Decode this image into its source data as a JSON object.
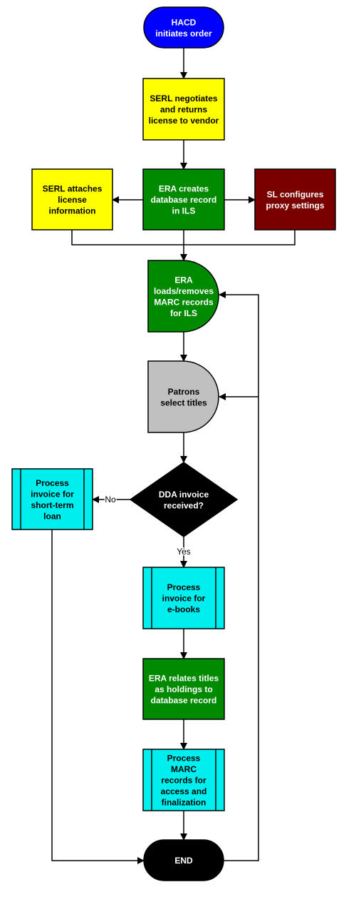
{
  "colors": {
    "start": "#0000ff",
    "yellow": "#ffff00",
    "green": "#008a00",
    "maroon": "#7a0000",
    "gray": "#c0c0c0",
    "cyan": "#00eeee",
    "black": "#000000"
  },
  "nodes": [
    {
      "id": "hacd",
      "shape": "terminator",
      "fill": "start",
      "text_color": "#ffffff",
      "lines": [
        "HACD",
        "initiates order"
      ]
    },
    {
      "id": "serl_negotiates",
      "shape": "process",
      "fill": "yellow",
      "text_color": "#000000",
      "lines": [
        "SERL negotiates",
        "and returns",
        "license to vendor"
      ]
    },
    {
      "id": "serl_attaches",
      "shape": "process",
      "fill": "yellow",
      "text_color": "#000000",
      "lines": [
        "SERL attaches",
        "license",
        "information"
      ]
    },
    {
      "id": "era_creates",
      "shape": "process",
      "fill": "green",
      "text_color": "#ffffff",
      "lines": [
        "ERA creates",
        "database record",
        "in ILS"
      ]
    },
    {
      "id": "sl_configures",
      "shape": "process",
      "fill": "maroon",
      "text_color": "#ffffff",
      "lines": [
        "SL configures",
        "proxy settings"
      ]
    },
    {
      "id": "era_loads",
      "shape": "delay",
      "fill": "green",
      "text_color": "#ffffff",
      "lines": [
        "ERA",
        "loads/removes",
        "MARC records",
        "for ILS"
      ]
    },
    {
      "id": "patrons",
      "shape": "delay",
      "fill": "gray",
      "text_color": "#000000",
      "lines": [
        "Patrons",
        "select titles"
      ]
    },
    {
      "id": "dda",
      "shape": "decision",
      "fill": "black",
      "text_color": "#ffffff",
      "lines": [
        "DDA invoice",
        "received?"
      ]
    },
    {
      "id": "short_term",
      "shape": "predefined",
      "fill": "cyan",
      "text_color": "#000000",
      "lines": [
        "Process",
        "invoice for",
        "short-term",
        "loan"
      ]
    },
    {
      "id": "ebooks",
      "shape": "predefined",
      "fill": "cyan",
      "text_color": "#000000",
      "lines": [
        "Process",
        "invoice for",
        "e-books"
      ]
    },
    {
      "id": "era_relates",
      "shape": "process",
      "fill": "green",
      "text_color": "#ffffff",
      "lines": [
        "ERA relates titles",
        "as holdings to",
        "database record"
      ]
    },
    {
      "id": "process_marc",
      "shape": "predefined",
      "fill": "cyan",
      "text_color": "#000000",
      "lines": [
        "Process",
        "MARC",
        "records for",
        "access and",
        "finalization"
      ]
    },
    {
      "id": "end",
      "shape": "terminator",
      "fill": "black",
      "text_color": "#ffffff",
      "lines": [
        "END"
      ]
    }
  ],
  "edges": [
    {
      "from": "hacd",
      "to": "serl_negotiates"
    },
    {
      "from": "serl_negotiates",
      "to": "era_creates"
    },
    {
      "from": "era_creates",
      "to": "serl_attaches"
    },
    {
      "from": "era_creates",
      "to": "sl_configures"
    },
    {
      "from": "era_creates",
      "to": "era_loads"
    },
    {
      "from": "serl_attaches",
      "to": "era_loads"
    },
    {
      "from": "sl_configures",
      "to": "era_loads"
    },
    {
      "from": "era_loads",
      "to": "patrons"
    },
    {
      "from": "patrons",
      "to": "dda"
    },
    {
      "from": "dda",
      "to": "short_term",
      "label": "No"
    },
    {
      "from": "dda",
      "to": "ebooks",
      "label": "Yes"
    },
    {
      "from": "ebooks",
      "to": "era_relates"
    },
    {
      "from": "era_relates",
      "to": "process_marc"
    },
    {
      "from": "process_marc",
      "to": "end"
    },
    {
      "from": "short_term",
      "to": "end"
    },
    {
      "from": "end",
      "to": "era_loads"
    },
    {
      "from": "end",
      "to": "patrons"
    }
  ]
}
